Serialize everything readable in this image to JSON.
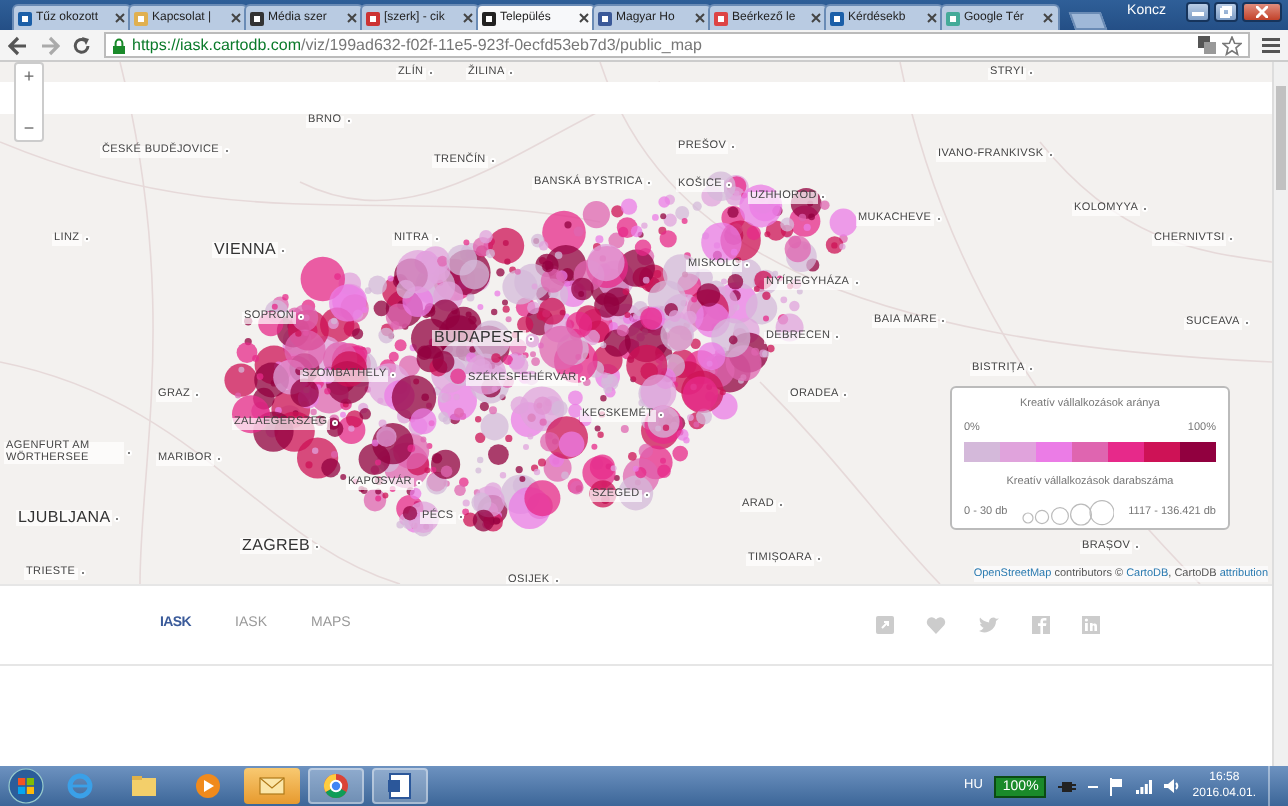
{
  "browser": {
    "tabs": [
      {
        "label": "Tűz okozott",
        "selected": false
      },
      {
        "label": "Kapcsolat |",
        "selected": false
      },
      {
        "label": "Média szer",
        "selected": false
      },
      {
        "label": "[szerk] - cik",
        "selected": false
      },
      {
        "label": "Település",
        "selected": true
      },
      {
        "label": "Magyar Ho",
        "selected": false
      },
      {
        "label": "Beérkező le",
        "selected": false
      },
      {
        "label": "Kérdésekb",
        "selected": false
      },
      {
        "label": "Google Tér",
        "selected": false
      }
    ],
    "user": "Koncz",
    "url_host": "https://iask.cartodb.com",
    "url_path": "/viz/199ad632-f02f-11e5-923f-0ecfd53eb7d3/public_map"
  },
  "map": {
    "zoom_in": "+",
    "zoom_out": "−",
    "cities": [
      {
        "name": "ZLÍN",
        "kind": "minor"
      },
      {
        "name": "ŽILINA",
        "kind": "minor"
      },
      {
        "name": "STRYI",
        "kind": "minor"
      },
      {
        "name": "BRNO",
        "kind": "minor"
      },
      {
        "name": "PREŠOV",
        "kind": "minor"
      },
      {
        "name": "ČESKÉ BUDĚJOVICE",
        "kind": "minor"
      },
      {
        "name": "TRENČÍN",
        "kind": "minor"
      },
      {
        "name": "IVANO-FRANKIVSK",
        "kind": "minor"
      },
      {
        "name": "BANSKÁ BYSTRICA",
        "kind": "minor"
      },
      {
        "name": "KOŠICE",
        "kind": "minor"
      },
      {
        "name": "UZHHOROD",
        "kind": "minor"
      },
      {
        "name": "KOLOMYYA",
        "kind": "minor"
      },
      {
        "name": "MUKACHEVE",
        "kind": "minor"
      },
      {
        "name": "LINZ",
        "kind": "minor"
      },
      {
        "name": "NITRA",
        "kind": "minor"
      },
      {
        "name": "VIENNA",
        "kind": "major"
      },
      {
        "name": "CHERNIVTSI",
        "kind": "minor"
      },
      {
        "name": "MISKOLC",
        "kind": "minor"
      },
      {
        "name": "NYÍREGYHÁZA",
        "kind": "minor"
      },
      {
        "name": "SOPRON",
        "kind": "minor"
      },
      {
        "name": "BAIA MARE",
        "kind": "minor"
      },
      {
        "name": "SUCEAVA",
        "kind": "minor"
      },
      {
        "name": "DEBRECEN",
        "kind": "minor"
      },
      {
        "name": "BUDAPEST",
        "kind": "major"
      },
      {
        "name": "SZOMBATHELY",
        "kind": "minor"
      },
      {
        "name": "SZÉKESFEHÉRVÁR",
        "kind": "minor"
      },
      {
        "name": "BISTRIȚA",
        "kind": "minor"
      },
      {
        "name": "GRAZ",
        "kind": "minor"
      },
      {
        "name": "ORADEA",
        "kind": "minor"
      },
      {
        "name": "KECSKEMÉT",
        "kind": "minor"
      },
      {
        "name": "ZALAEGERSZEG",
        "kind": "minor"
      },
      {
        "name": "AGENFURT AM WÖRTHERSEE",
        "kind": "minor"
      },
      {
        "name": "MARIBOR",
        "kind": "minor"
      },
      {
        "name": "KAPOSVÁR",
        "kind": "minor"
      },
      {
        "name": "SZEGED",
        "kind": "minor"
      },
      {
        "name": "ARAD",
        "kind": "minor"
      },
      {
        "name": "PÉCS",
        "kind": "minor"
      },
      {
        "name": "LJUBLJANA",
        "kind": "major"
      },
      {
        "name": "ZAGREB",
        "kind": "major"
      },
      {
        "name": "TIMIȘOARA",
        "kind": "minor"
      },
      {
        "name": "TRIESTE",
        "kind": "minor"
      },
      {
        "name": "OSIJEK",
        "kind": "minor"
      },
      {
        "name": "BRAȘOV",
        "kind": "minor"
      }
    ],
    "legend": {
      "ratio_title": "Kreatív vállalkozások aránya",
      "min_label": "0%",
      "max_label": "100%",
      "ramp": [
        {
          "color": "#d4b9da"
        },
        {
          "color": "#e0a3dc"
        },
        {
          "color": "#eb7ce6"
        },
        {
          "color": "#df65b0"
        },
        {
          "color": "#e7298a"
        },
        {
          "color": "#ce1256"
        },
        {
          "color": "#91003f"
        }
      ],
      "count_title": "Kreatív vállalkozások darabszáma",
      "count_min": "0 - 30 db",
      "count_max": "1117 - 136.421 db"
    },
    "attribution": {
      "osm_link": "OpenStreetMap",
      "text_1": "contributors ©",
      "cartodb_link": "CartoDB",
      "text_2": ", CartoDB",
      "attribution_link": "attribution"
    }
  },
  "footer": {
    "logo": "IASK",
    "links": [
      "IASK",
      "MAPS"
    ]
  },
  "taskbar": {
    "language": "HU",
    "battery": "100%",
    "time": "16:58",
    "date": "2016.04.01."
  }
}
